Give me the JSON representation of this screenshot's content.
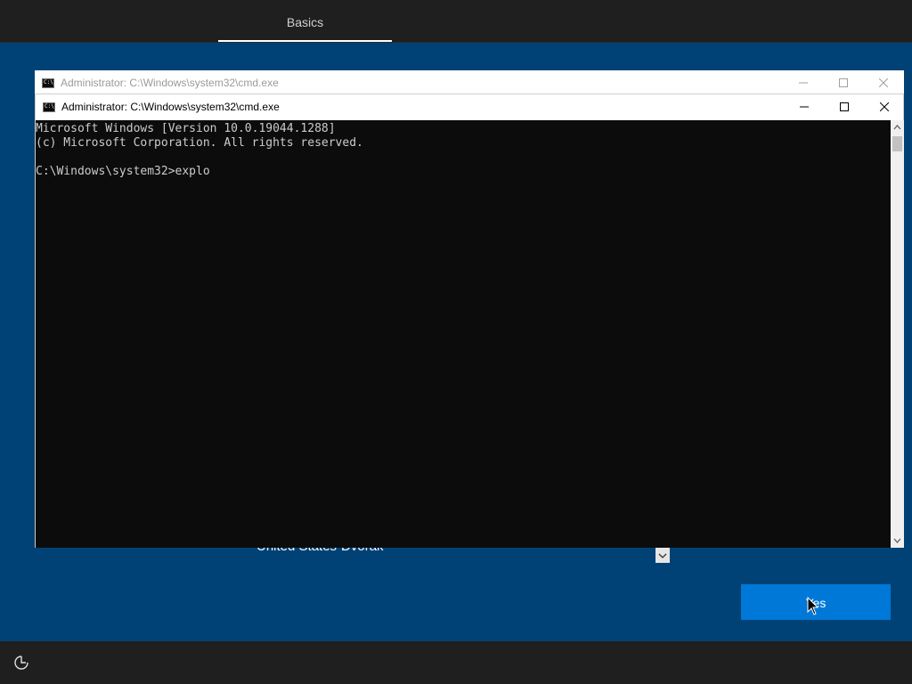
{
  "oobe": {
    "tab_label": "Basics",
    "keyboard_layout_value": "United States-Dvorak",
    "yes_button_label": "Yes"
  },
  "cmd_back": {
    "title": "Administrator: C:\\Windows\\system32\\cmd.exe"
  },
  "cmd_front": {
    "title": "Administrator: C:\\Windows\\system32\\cmd.exe",
    "console_lines": [
      "Microsoft Windows [Version 10.0.19044.1288]",
      "(c) Microsoft Corporation. All rights reserved.",
      "",
      "C:\\Windows\\system32>explo"
    ]
  },
  "icons": {
    "title_icon": "cmd-icon",
    "minimize": "minimize-icon",
    "maximize": "maximize-icon",
    "close": "close-icon",
    "accessibility": "accessibility-icon",
    "dropdown": "chevron-down-icon"
  },
  "colors": {
    "background": "#004275",
    "accent": "#0078d7",
    "console_bg": "#0c0c0c",
    "console_fg": "#cccccc"
  }
}
